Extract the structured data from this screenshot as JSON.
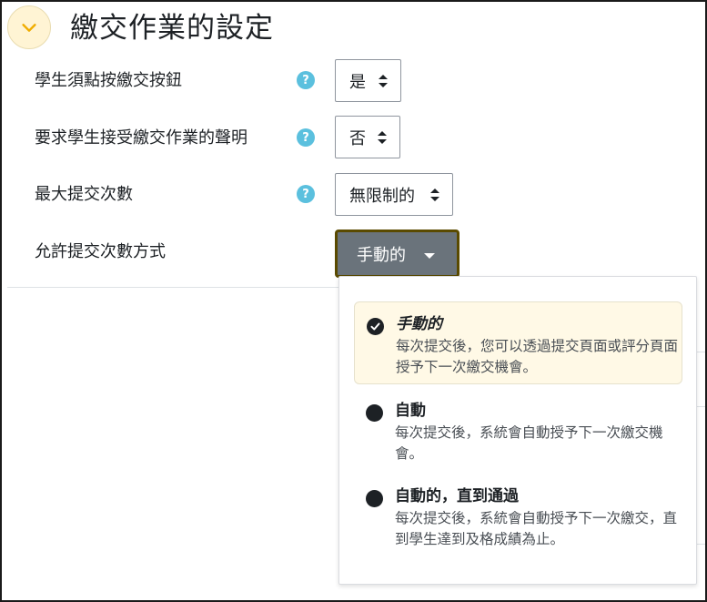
{
  "section": {
    "title": "繳交作業的設定",
    "toggle_icon": "chevron-down-icon"
  },
  "settings": [
    {
      "label": "學生須點按繳交按鈕",
      "help": "?",
      "value": "是"
    },
    {
      "label": "要求學生接受繳交作業的聲明",
      "help": "?",
      "value": "否"
    },
    {
      "label": "最大提交次數",
      "help": "?",
      "value": "無限制的"
    }
  ],
  "reopen": {
    "label": "允許提交次數方式",
    "button_label": "手動的"
  },
  "options": [
    {
      "title": "手動的",
      "desc": "每次提交後，您可以透過提交頁面或評分頁面授予下一次繳交機會。",
      "selected": true
    },
    {
      "title": "自動",
      "desc": "每次提交後，系統會自動授予下一次繳交機會。",
      "selected": false
    },
    {
      "title": "自動的，直到通過",
      "desc": "每次提交後，系統會自動授予下一次繳交，直到學生達到及格成績為止。",
      "selected": false
    }
  ],
  "colors": {
    "accent_bg": "#fff4d4",
    "help": "#5bc0de",
    "button": "#6a737b",
    "focus_border": "#5a4a00"
  }
}
